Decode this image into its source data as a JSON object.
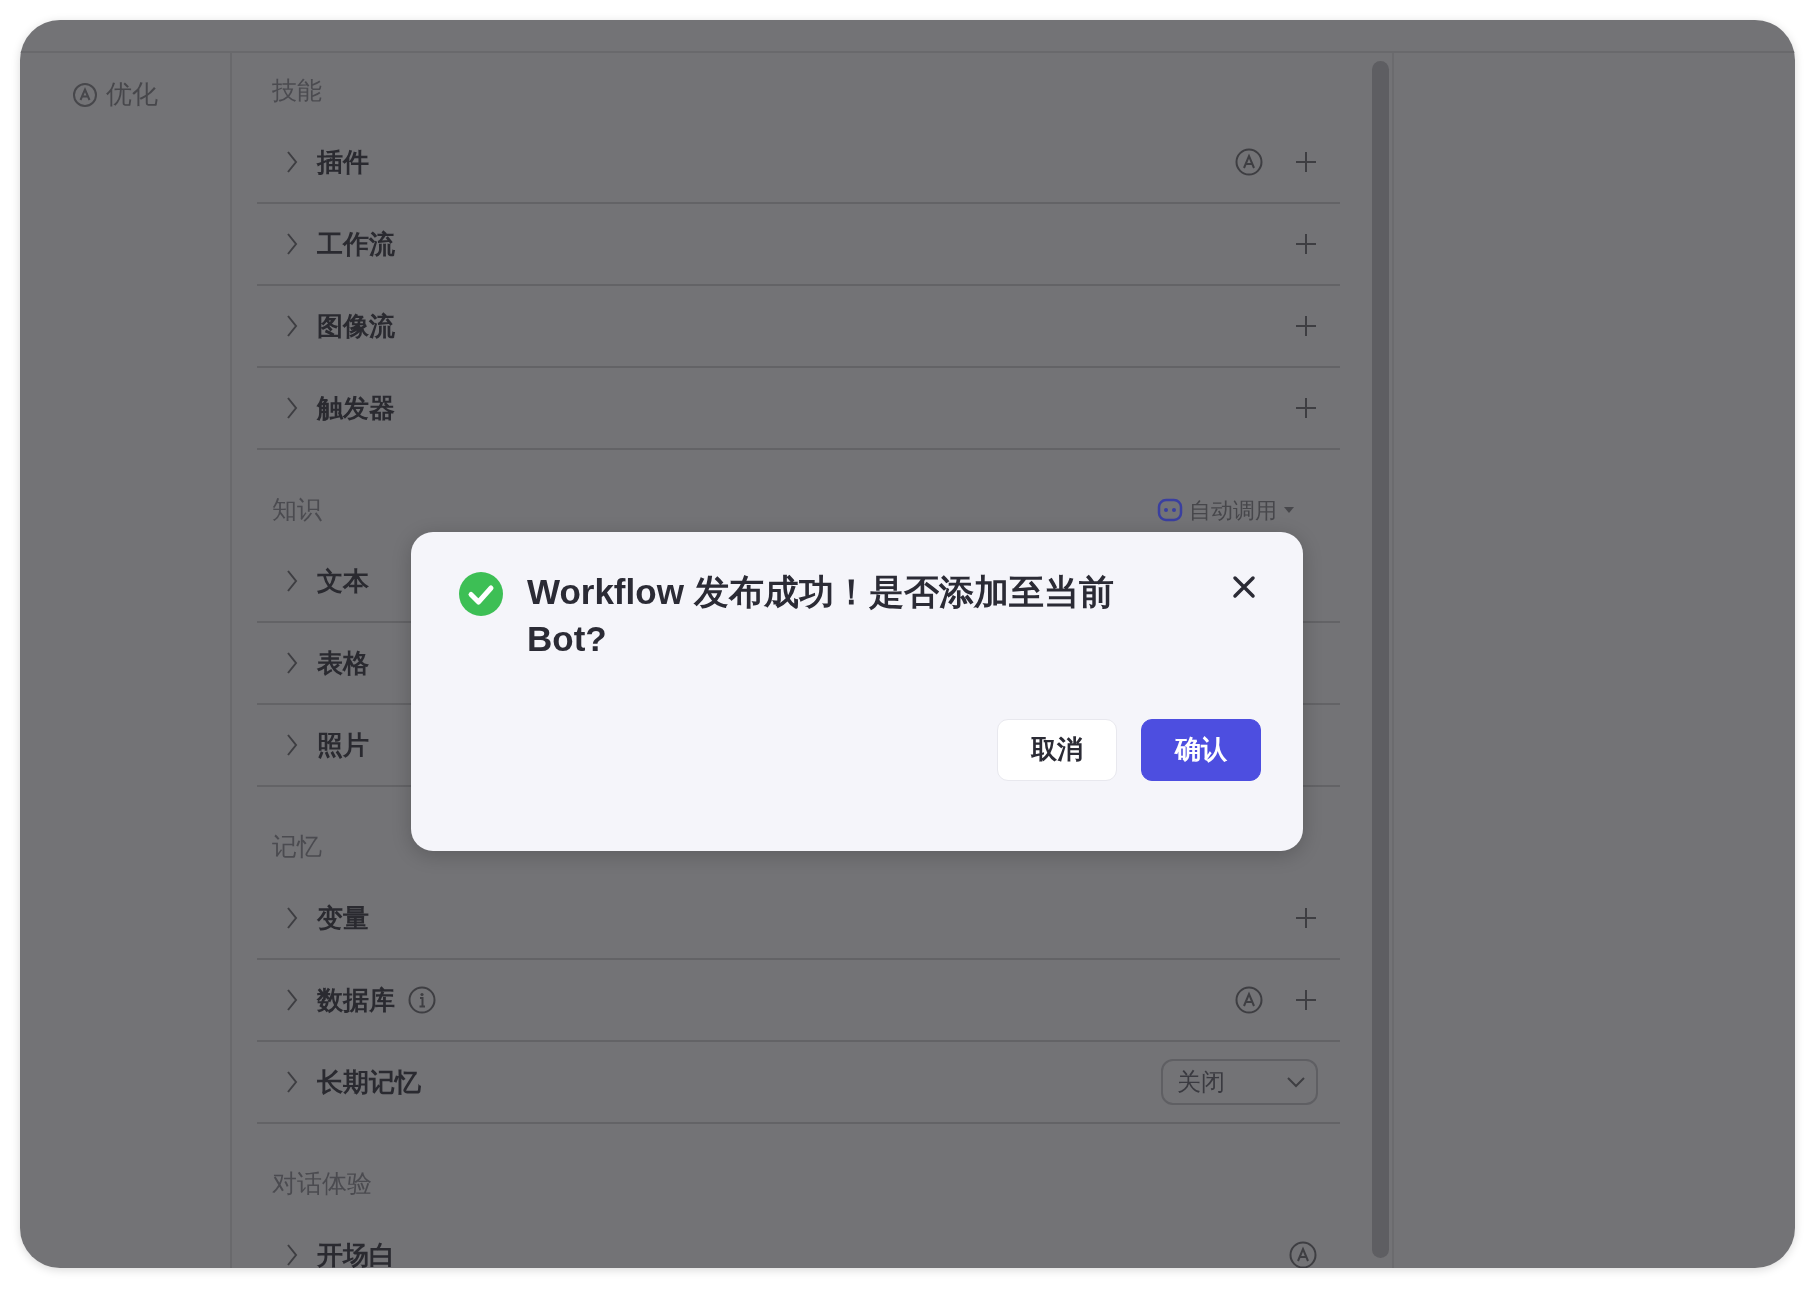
{
  "sidebar": {
    "label": "优化"
  },
  "sections": [
    {
      "title": "技能",
      "items": [
        {
          "label": "插件",
          "info": false,
          "auto": true,
          "add": true
        },
        {
          "label": "工作流",
          "info": false,
          "auto": false,
          "add": true
        },
        {
          "label": "图像流",
          "info": false,
          "auto": false,
          "add": true
        },
        {
          "label": "触发器",
          "info": false,
          "auto": false,
          "add": true
        }
      ]
    },
    {
      "title": "知识",
      "control": {
        "label": "自动调用"
      },
      "items": [
        {
          "label": "文本",
          "info": false,
          "auto": false,
          "add": false
        },
        {
          "label": "表格",
          "info": false,
          "auto": false,
          "add": false
        },
        {
          "label": "照片",
          "info": false,
          "auto": false,
          "add": false
        }
      ]
    },
    {
      "title": "记忆",
      "items": [
        {
          "label": "变量",
          "info": false,
          "auto": false,
          "add": true
        },
        {
          "label": "数据库",
          "info": true,
          "auto": true,
          "add": true
        },
        {
          "label": "长期记忆",
          "info": false,
          "auto": false,
          "add": false,
          "select": "关闭"
        }
      ]
    },
    {
      "title": "对话体验",
      "items": [
        {
          "label": "开场白",
          "info": false,
          "auto": true,
          "add": false
        }
      ]
    }
  ],
  "dialog": {
    "message": "Workflow 发布成功！是否添加至当前 Bot?",
    "buttons": [
      {
        "label": "取消",
        "kind": "secondary"
      },
      {
        "label": "确认",
        "kind": "primary"
      }
    ]
  }
}
